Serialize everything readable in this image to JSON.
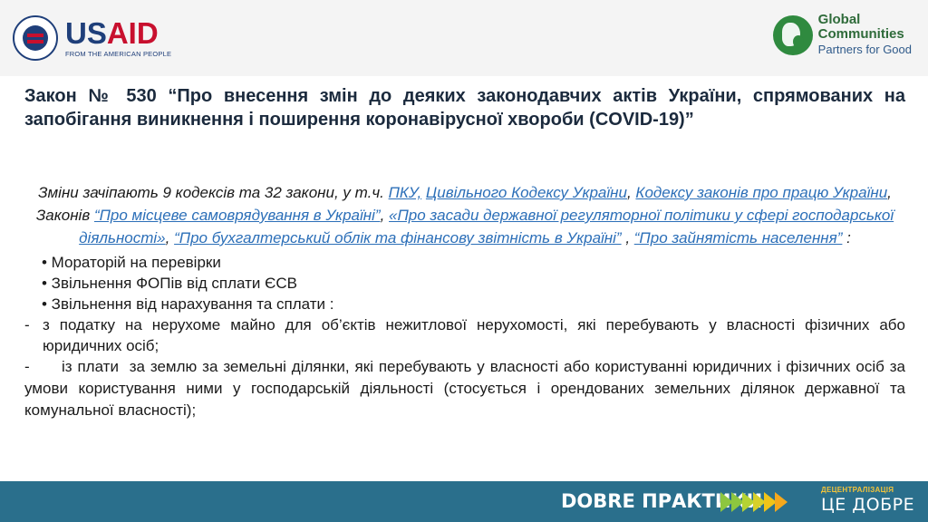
{
  "header": {
    "usaid": {
      "us": "US",
      "aid": "AID",
      "tagline": "FROM THE AMERICAN PEOPLE"
    },
    "gc": {
      "line1": "Global",
      "line2": "Communities",
      "tagline": "Partners for Good"
    }
  },
  "title": "Закон № 530 “Про внесення змін до деяких законодавчих актів України, спрямованих на запобігання виникнення і поширення коронавірусної хвороби (COVID-19)”",
  "intro": {
    "t1": "Зміни зачіпають  9 кодексів та 32 закони, у т.ч. ",
    "l1": "ПКУ,",
    "t2": " ",
    "l2": "Цивільного Кодексу України",
    "t3": ",  ",
    "l3": "Кодексу законів про працю України",
    "t4": ", Законів  ",
    "l4": "“Про місцеве самоврядування в Україні”",
    "t5": ", ",
    "l5": "«Про засади державної регуляторної політики у сфері господарської діяльності»",
    "t6": ", ",
    "l6": "“Про бухгалтерський облік та фінансову звітність в Україні”",
    "t7": " , ",
    "l7": "“Про зайнятість населення”",
    "t8": " :"
  },
  "bullets": [
    "• Мораторій на перевірки",
    "• Звільнення ФОПів від сплати ЄСВ",
    "• Звільнення від нарахування та сплати :"
  ],
  "dash_items": [
    {
      "mark": "-",
      "text": "з податку на нерухоме майно для об’єктів нежитлової нерухомості, які перебувають у власності фізичних або юридичних осіб;"
    },
    {
      "mark": "-",
      "text": "      із плати  за землю за земельні ділянки, які перебувають у власності або користуванні юридичних і фізичних осіб за умови користування ними у господарській діяльності (стосується і орендованих земельних ділянок державної та комунальної власності);"
    }
  ],
  "footer": {
    "label": "DOBRE ПРАКТИКИ",
    "decentr_top": "ДЕЦЕНТРАЛІЗАЦІЯ",
    "decentr_main": "ЦЕ ДОБРЕ",
    "chevron_colors": [
      "#8dc63f",
      "#b5d334",
      "#f0c419",
      "#f5a81c"
    ],
    "bg_color": "#2a6f8c"
  }
}
